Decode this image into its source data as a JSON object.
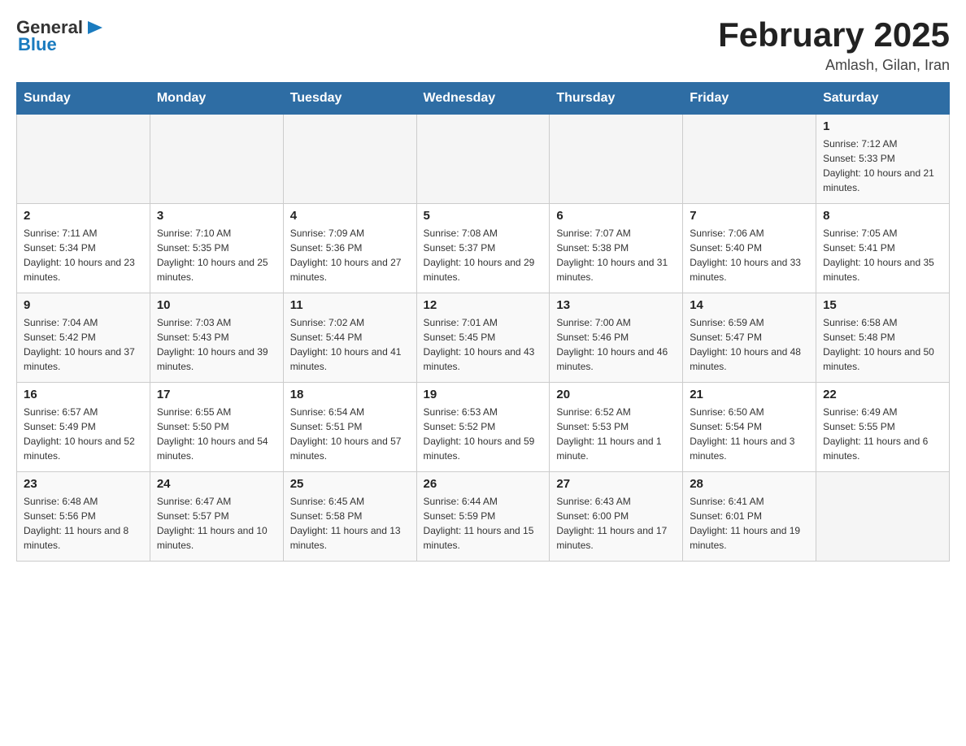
{
  "header": {
    "logo": {
      "general": "General",
      "arrow_icon": "▶",
      "blue": "Blue"
    },
    "title": "February 2025",
    "location": "Amlash, Gilan, Iran"
  },
  "days_of_week": [
    "Sunday",
    "Monday",
    "Tuesday",
    "Wednesday",
    "Thursday",
    "Friday",
    "Saturday"
  ],
  "weeks": [
    [
      {
        "day": "",
        "sunrise": "",
        "sunset": "",
        "daylight": ""
      },
      {
        "day": "",
        "sunrise": "",
        "sunset": "",
        "daylight": ""
      },
      {
        "day": "",
        "sunrise": "",
        "sunset": "",
        "daylight": ""
      },
      {
        "day": "",
        "sunrise": "",
        "sunset": "",
        "daylight": ""
      },
      {
        "day": "",
        "sunrise": "",
        "sunset": "",
        "daylight": ""
      },
      {
        "day": "",
        "sunrise": "",
        "sunset": "",
        "daylight": ""
      },
      {
        "day": "1",
        "sunrise": "Sunrise: 7:12 AM",
        "sunset": "Sunset: 5:33 PM",
        "daylight": "Daylight: 10 hours and 21 minutes."
      }
    ],
    [
      {
        "day": "2",
        "sunrise": "Sunrise: 7:11 AM",
        "sunset": "Sunset: 5:34 PM",
        "daylight": "Daylight: 10 hours and 23 minutes."
      },
      {
        "day": "3",
        "sunrise": "Sunrise: 7:10 AM",
        "sunset": "Sunset: 5:35 PM",
        "daylight": "Daylight: 10 hours and 25 minutes."
      },
      {
        "day": "4",
        "sunrise": "Sunrise: 7:09 AM",
        "sunset": "Sunset: 5:36 PM",
        "daylight": "Daylight: 10 hours and 27 minutes."
      },
      {
        "day": "5",
        "sunrise": "Sunrise: 7:08 AM",
        "sunset": "Sunset: 5:37 PM",
        "daylight": "Daylight: 10 hours and 29 minutes."
      },
      {
        "day": "6",
        "sunrise": "Sunrise: 7:07 AM",
        "sunset": "Sunset: 5:38 PM",
        "daylight": "Daylight: 10 hours and 31 minutes."
      },
      {
        "day": "7",
        "sunrise": "Sunrise: 7:06 AM",
        "sunset": "Sunset: 5:40 PM",
        "daylight": "Daylight: 10 hours and 33 minutes."
      },
      {
        "day": "8",
        "sunrise": "Sunrise: 7:05 AM",
        "sunset": "Sunset: 5:41 PM",
        "daylight": "Daylight: 10 hours and 35 minutes."
      }
    ],
    [
      {
        "day": "9",
        "sunrise": "Sunrise: 7:04 AM",
        "sunset": "Sunset: 5:42 PM",
        "daylight": "Daylight: 10 hours and 37 minutes."
      },
      {
        "day": "10",
        "sunrise": "Sunrise: 7:03 AM",
        "sunset": "Sunset: 5:43 PM",
        "daylight": "Daylight: 10 hours and 39 minutes."
      },
      {
        "day": "11",
        "sunrise": "Sunrise: 7:02 AM",
        "sunset": "Sunset: 5:44 PM",
        "daylight": "Daylight: 10 hours and 41 minutes."
      },
      {
        "day": "12",
        "sunrise": "Sunrise: 7:01 AM",
        "sunset": "Sunset: 5:45 PM",
        "daylight": "Daylight: 10 hours and 43 minutes."
      },
      {
        "day": "13",
        "sunrise": "Sunrise: 7:00 AM",
        "sunset": "Sunset: 5:46 PM",
        "daylight": "Daylight: 10 hours and 46 minutes."
      },
      {
        "day": "14",
        "sunrise": "Sunrise: 6:59 AM",
        "sunset": "Sunset: 5:47 PM",
        "daylight": "Daylight: 10 hours and 48 minutes."
      },
      {
        "day": "15",
        "sunrise": "Sunrise: 6:58 AM",
        "sunset": "Sunset: 5:48 PM",
        "daylight": "Daylight: 10 hours and 50 minutes."
      }
    ],
    [
      {
        "day": "16",
        "sunrise": "Sunrise: 6:57 AM",
        "sunset": "Sunset: 5:49 PM",
        "daylight": "Daylight: 10 hours and 52 minutes."
      },
      {
        "day": "17",
        "sunrise": "Sunrise: 6:55 AM",
        "sunset": "Sunset: 5:50 PM",
        "daylight": "Daylight: 10 hours and 54 minutes."
      },
      {
        "day": "18",
        "sunrise": "Sunrise: 6:54 AM",
        "sunset": "Sunset: 5:51 PM",
        "daylight": "Daylight: 10 hours and 57 minutes."
      },
      {
        "day": "19",
        "sunrise": "Sunrise: 6:53 AM",
        "sunset": "Sunset: 5:52 PM",
        "daylight": "Daylight: 10 hours and 59 minutes."
      },
      {
        "day": "20",
        "sunrise": "Sunrise: 6:52 AM",
        "sunset": "Sunset: 5:53 PM",
        "daylight": "Daylight: 11 hours and 1 minute."
      },
      {
        "day": "21",
        "sunrise": "Sunrise: 6:50 AM",
        "sunset": "Sunset: 5:54 PM",
        "daylight": "Daylight: 11 hours and 3 minutes."
      },
      {
        "day": "22",
        "sunrise": "Sunrise: 6:49 AM",
        "sunset": "Sunset: 5:55 PM",
        "daylight": "Daylight: 11 hours and 6 minutes."
      }
    ],
    [
      {
        "day": "23",
        "sunrise": "Sunrise: 6:48 AM",
        "sunset": "Sunset: 5:56 PM",
        "daylight": "Daylight: 11 hours and 8 minutes."
      },
      {
        "day": "24",
        "sunrise": "Sunrise: 6:47 AM",
        "sunset": "Sunset: 5:57 PM",
        "daylight": "Daylight: 11 hours and 10 minutes."
      },
      {
        "day": "25",
        "sunrise": "Sunrise: 6:45 AM",
        "sunset": "Sunset: 5:58 PM",
        "daylight": "Daylight: 11 hours and 13 minutes."
      },
      {
        "day": "26",
        "sunrise": "Sunrise: 6:44 AM",
        "sunset": "Sunset: 5:59 PM",
        "daylight": "Daylight: 11 hours and 15 minutes."
      },
      {
        "day": "27",
        "sunrise": "Sunrise: 6:43 AM",
        "sunset": "Sunset: 6:00 PM",
        "daylight": "Daylight: 11 hours and 17 minutes."
      },
      {
        "day": "28",
        "sunrise": "Sunrise: 6:41 AM",
        "sunset": "Sunset: 6:01 PM",
        "daylight": "Daylight: 11 hours and 19 minutes."
      },
      {
        "day": "",
        "sunrise": "",
        "sunset": "",
        "daylight": ""
      }
    ]
  ]
}
